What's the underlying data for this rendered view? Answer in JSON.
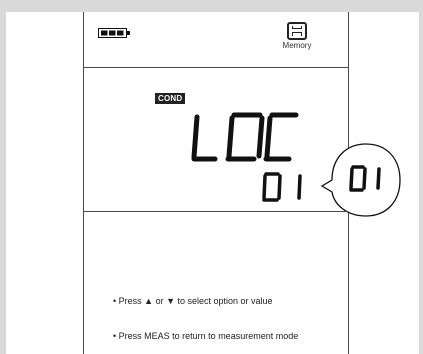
{
  "display": {
    "mode_badge": "COND",
    "main_text": "LOC",
    "sub_value": "01",
    "callout_value": "01",
    "memory_label": "Memory"
  },
  "icons": {
    "battery": "battery-icon",
    "memory": "memory-icon"
  },
  "instructions": [
    "• Press ▲ or ▼ to select option or value",
    "• Press MEAS to return to measurement mode"
  ]
}
